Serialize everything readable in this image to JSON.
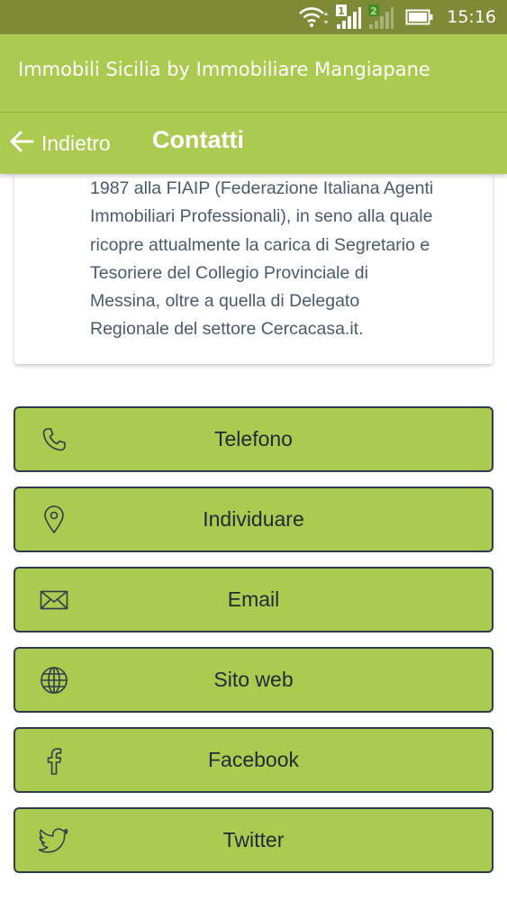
{
  "status_bar": {
    "sim1_label": "1",
    "sim2_label": "2",
    "time": "15:16"
  },
  "header": {
    "app_title": "Immobili Sicilia by Immobiliare Mangiapane"
  },
  "nav": {
    "back_label": "Indietro",
    "page_title": "Contatti"
  },
  "description": {
    "lines": [
      "1987 alla FIAIP (Federazione Italiana Agenti",
      "Immobiliari Professionali), in seno alla quale",
      "ricopre attualmente la carica di Segretario e",
      "Tesoriere del Collegio Provinciale di",
      "Messina, oltre a quella di Delegato",
      "Regionale del settore Cercacasa.it."
    ]
  },
  "contacts": [
    {
      "label": "Telefono",
      "icon": "phone-icon"
    },
    {
      "label": "Individuare",
      "icon": "location-pin-icon"
    },
    {
      "label": "Email",
      "icon": "envelope-icon"
    },
    {
      "label": "Sito web",
      "icon": "globe-icon"
    },
    {
      "label": "Facebook",
      "icon": "facebook-icon"
    },
    {
      "label": "Twitter",
      "icon": "twitter-icon"
    }
  ],
  "colors": {
    "status_bar": "#7e8a35",
    "primary": "#abca50",
    "button_border": "#2d3c4a",
    "body_text": "#4a5a6e"
  }
}
